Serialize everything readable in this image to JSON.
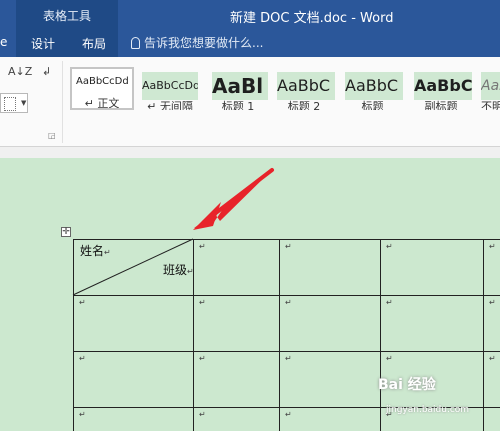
{
  "titlebar": {
    "context_group": "表格工具",
    "doc_title": "新建 DOC 文档.doc - Word",
    "tabs": [
      {
        "label": "e"
      },
      {
        "label": "设计"
      },
      {
        "label": "布局"
      }
    ],
    "tell_me": "告诉我您想要做什么..."
  },
  "ribbon": {
    "sort_icon": "sort-az-icon",
    "styles": [
      {
        "sample": "AaBbCcDd",
        "caption": "↵ 正文",
        "selected": true
      },
      {
        "sample": "AaBbCcDd",
        "caption": "↵ 无间隔"
      },
      {
        "sample": "AaBl",
        "caption": "标题 1"
      },
      {
        "sample": "AaBbC",
        "caption": "标题 2"
      },
      {
        "sample": "AaBbC",
        "caption": "标题"
      },
      {
        "sample": "AaBbC",
        "caption": "副标题"
      },
      {
        "sample": "AaB",
        "caption": "不明"
      }
    ]
  },
  "table": {
    "cell_name": "姓名",
    "cell_class": "班级"
  },
  "annotation": {
    "arrow_color": "#e8232a"
  },
  "watermark": {
    "text": "Bai 经验",
    "sub": "jingyan.baidu.com"
  },
  "colors": {
    "title_bar": "#2b579a",
    "doc_bg": "#cce8cf",
    "style_highlight": "#cfe8d2"
  }
}
